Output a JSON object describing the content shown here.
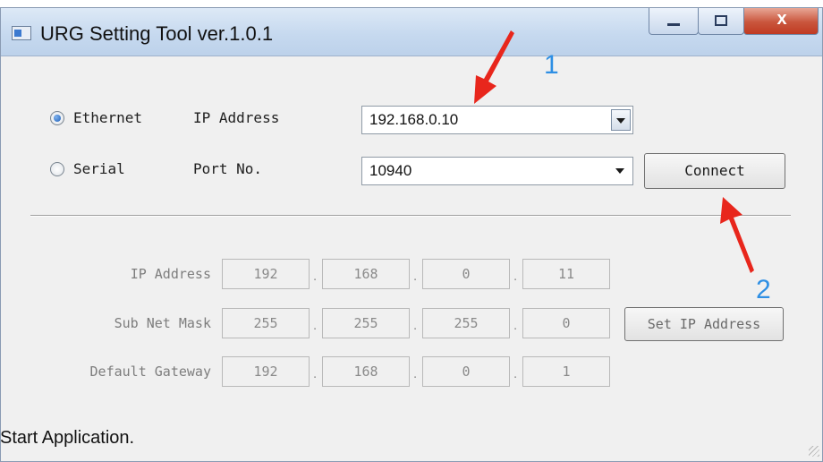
{
  "window": {
    "title": "URG Setting Tool ver.1.0.1",
    "close_glyph": "x"
  },
  "connection": {
    "ethernet": {
      "radio_label": "Ethernet",
      "field_label": "IP Address",
      "value": "192.168.0.10",
      "selected": true
    },
    "serial": {
      "radio_label": "Serial",
      "field_label": "Port No.",
      "value": "10940",
      "selected": false
    },
    "connect_label": "Connect"
  },
  "network": {
    "ip_address": {
      "label": "IP Address",
      "octets": [
        "192",
        "168",
        "0",
        "11"
      ]
    },
    "subnet_mask": {
      "label": "Sub Net Mask",
      "octets": [
        "255",
        "255",
        "255",
        "0"
      ]
    },
    "default_gateway": {
      "label": "Default Gateway",
      "octets": [
        "192",
        "168",
        "0",
        "1"
      ]
    },
    "set_ip_label": "Set IP Address"
  },
  "status_text": "Start Application.",
  "annotations": {
    "marker_1": "1",
    "marker_2": "2",
    "arrow_color": "#e8261c",
    "number_color": "#2e8fe4"
  },
  "icons": [
    "app-window-icon",
    "minimize-icon",
    "maximize-icon",
    "close-icon",
    "dropdown-arrow-icon",
    "resize-grip-icon"
  ]
}
